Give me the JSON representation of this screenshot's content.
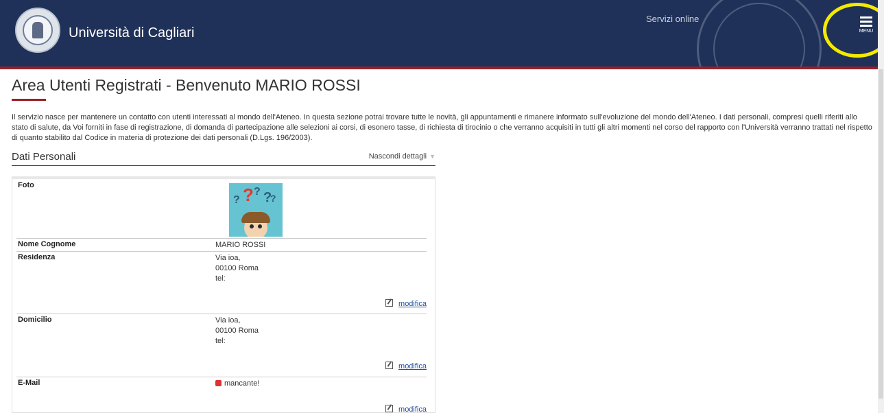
{
  "header": {
    "brand": "Università di Cagliari",
    "servizi_label": "Servizi online",
    "menu_label": "MENU",
    "colors": {
      "bar": "#1f3158",
      "accent": "#9c1f26",
      "highlight": "#f3ea00"
    },
    "logo_icon": "university-seal-icon",
    "menu_icon": "hamburger-icon"
  },
  "page": {
    "title": "Area Utenti Registrati - Benvenuto MARIO ROSSI",
    "intro": "Il servizio nasce per mantenere un contatto con utenti interessati al mondo dell'Ateneo. In questa sezione potrai trovare tutte le novità, gli appuntamenti e rimanere informato sull'evoluzione del mondo dell'Ateneo. I dati personali, compresi quelli riferiti allo stato di salute, da Voi forniti in fase di registrazione, di domanda di partecipazione alle selezioni ai corsi, di esonero tasse, di richiesta di tirocinio o che verranno acquisiti in tutti gli altri momenti nel corso del rapporto con l'Università verranno trattati nel rispetto di quanto stabilito dal Codice in materia di protezione dei dati personali (D.Lgs. 196/2003)."
  },
  "section": {
    "title": "Dati Personali",
    "toggle_label": "Nascondi dettagli",
    "rows": {
      "foto": {
        "label": "Foto"
      },
      "nome": {
        "label": "Nome Cognome",
        "value": "MARIO ROSSI"
      },
      "residenza": {
        "label": "Residenza",
        "line1": "Via ioa,",
        "line2": "00100 Roma",
        "line3": "tel:",
        "edit": "modifica"
      },
      "domicilio": {
        "label": "Domicilio",
        "line1": "Via ioa,",
        "line2": "00100 Roma",
        "line3": "tel:",
        "edit": "modifica"
      },
      "email": {
        "label": "E-Mail",
        "value": "mancante!",
        "edit": "modifica"
      }
    }
  }
}
